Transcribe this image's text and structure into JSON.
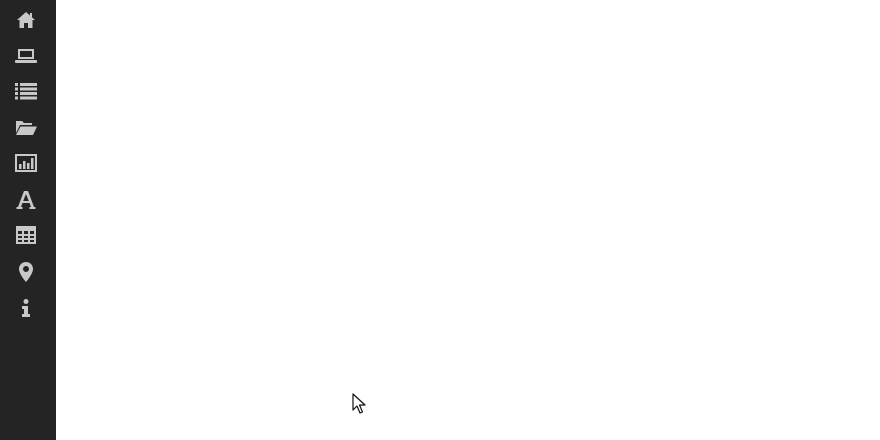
{
  "sidebar": {
    "items": [
      {
        "id": "home",
        "icon": "home-icon"
      },
      {
        "id": "devices",
        "icon": "laptop-icon"
      },
      {
        "id": "list",
        "icon": "list-icon"
      },
      {
        "id": "files",
        "icon": "folder-open-icon"
      },
      {
        "id": "charts",
        "icon": "bar-chart-icon"
      },
      {
        "id": "fonts",
        "icon": "font-icon"
      },
      {
        "id": "table",
        "icon": "table-icon"
      },
      {
        "id": "location",
        "icon": "map-marker-icon"
      },
      {
        "id": "info",
        "icon": "info-icon"
      }
    ]
  },
  "colors": {
    "sidebar_bg": "#242424",
    "icon": "#c8c8c8",
    "main_bg": "#ffffff"
  }
}
